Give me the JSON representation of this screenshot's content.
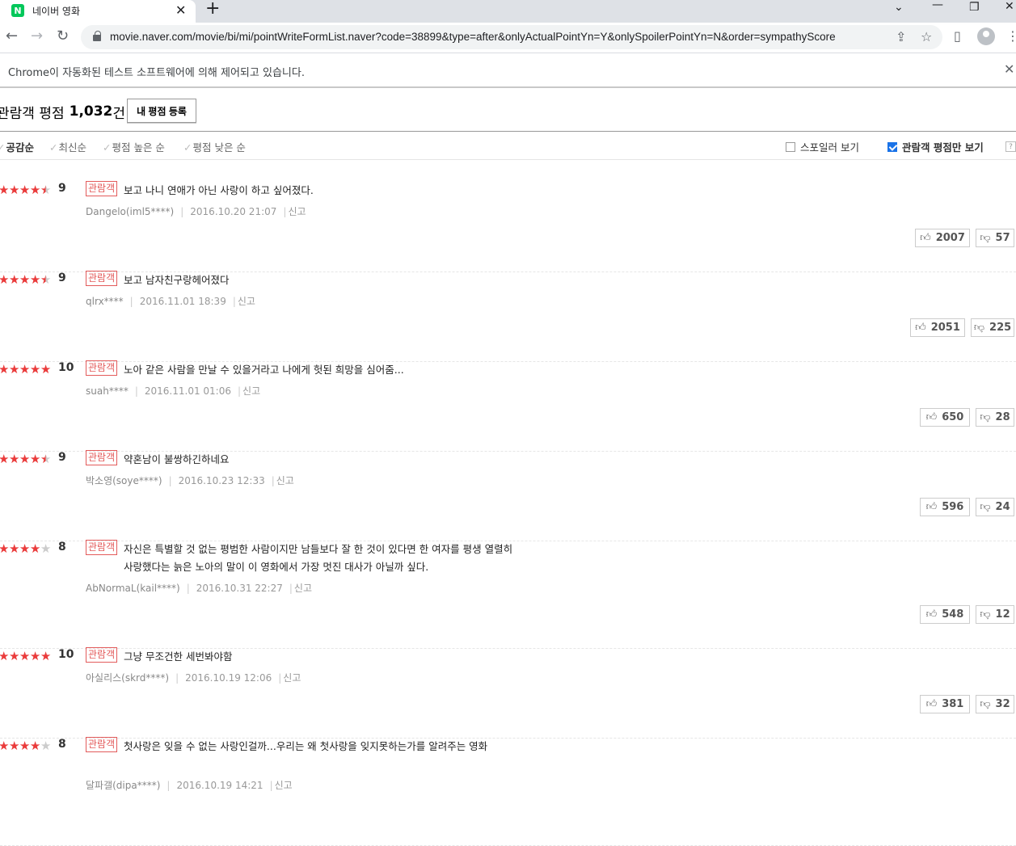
{
  "browser": {
    "tab_title": "네이버 영화",
    "tab_favicon_letter": "N",
    "url": "movie.naver.com/movie/bi/mi/pointWriteFormList.naver?code=38899&type=after&onlyActualPointYn=Y&onlySpoilerPointYn=N&order=sympathyScore",
    "infobar_text": "Chrome이 자동화된 테스트 소프트웨어에 의해 제어되고 있습니다."
  },
  "header": {
    "title": "관람객 평점",
    "count": "1,032",
    "unit": "건",
    "register_label": "내 평점 등록"
  },
  "sort": {
    "items": [
      "공감순",
      "최신순",
      "평점 높은 순",
      "평점 낮은 순"
    ],
    "active": "공감순",
    "spoiler_label": "스포일러 보기",
    "spoiler_checked": false,
    "audience_only_label": "관람객 평점만 보기",
    "audience_only_checked": true
  },
  "badge_label": "관람객",
  "report_label": "신고",
  "reviews": [
    {
      "rating": 9,
      "stars": 4.5,
      "text": "보고 나니 연애가 아닌 사랑이 하고 싶어졌다.",
      "author": "Dangelo(iml5****)",
      "date": "2016.10.20 21:07",
      "likes": "2007",
      "dislikes": "57"
    },
    {
      "rating": 9,
      "stars": 4.5,
      "text": "보고 남자친구랑헤어졌다",
      "author": "qlrx****",
      "date": "2016.11.01 18:39",
      "likes": "2051",
      "dislikes": "225"
    },
    {
      "rating": 10,
      "stars": 5,
      "text": "노아 같은 사람을 만날 수 있을거라고 나에게 헛된 희망을 심어줌...",
      "author": "suah****",
      "date": "2016.11.01 01:06",
      "likes": "650",
      "dislikes": "28"
    },
    {
      "rating": 9,
      "stars": 4.5,
      "text": "약혼남이 불쌍하긴하네요",
      "author": "박소영(soye****)",
      "date": "2016.10.23 12:33",
      "likes": "596",
      "dislikes": "24"
    },
    {
      "rating": 8,
      "stars": 4,
      "text": "자신은 특별할 것 없는 평범한 사람이지만 남들보다 잘 한 것이 있다면 한 여자를 평생 열렬히 사랑했다는 늙은 노아의 말이 이 영화에서 가장 멋진 대사가 아닐까 싶다.",
      "author": "AbNormaL(kail****)",
      "date": "2016.10.31 22:27",
      "likes": "548",
      "dislikes": "12"
    },
    {
      "rating": 10,
      "stars": 5,
      "text": "그냥 무조건한 세번봐야함",
      "author": "아실리스(skrd****)",
      "date": "2016.10.19 12:06",
      "likes": "381",
      "dislikes": "32"
    },
    {
      "rating": 8,
      "stars": 4,
      "text": "첫사랑은 잊을 수 없는 사랑인걸까...우리는 왜 첫사랑을 잊지못하는가를 알려주는 영화",
      "author": "달파갤(dipa****)",
      "date": "2016.10.19 14:21",
      "likes": "",
      "dislikes": ""
    }
  ]
}
